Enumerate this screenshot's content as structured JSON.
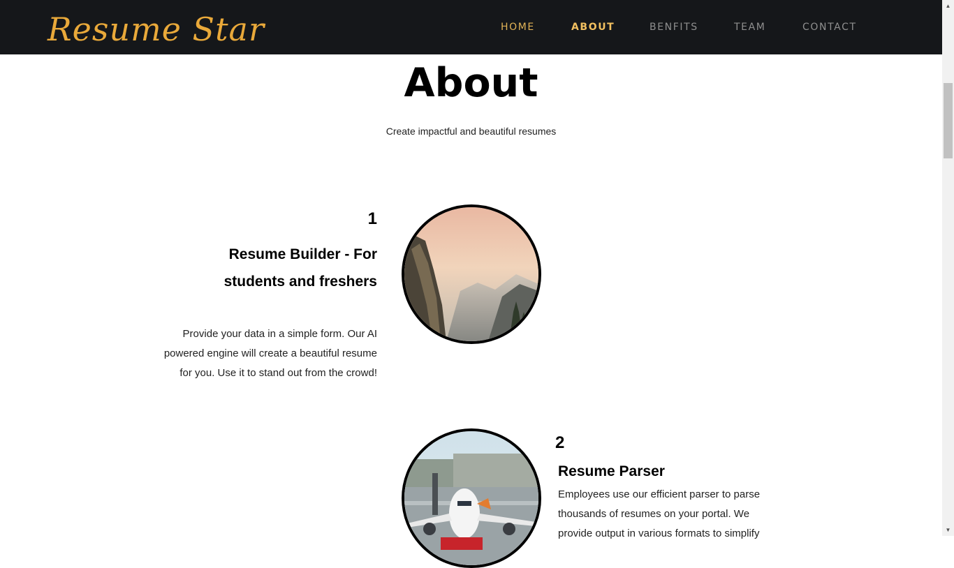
{
  "nav": {
    "brand": "Resume Star",
    "links": [
      "HOME",
      "ABOUT",
      "BENFITS",
      "TEAM",
      "CONTACT"
    ],
    "active": "ABOUT"
  },
  "about": {
    "title": "About",
    "subtitle": "Create impactful and beautiful resumes"
  },
  "items": [
    {
      "number": "1",
      "heading": "Resume Builder - For students and freshers",
      "description": "Provide your data in a simple form. Our AI powered engine will create a beautiful resume for you. Use it to stand out from the crowd!",
      "image": "mountain-valley-photo"
    },
    {
      "number": "2",
      "heading": "Resume Parser",
      "description": "Employees use our efficient parser to parse thousands of resumes on your portal. We provide output in various formats to simplify",
      "image": "airplane-photo"
    }
  ],
  "colors": {
    "navbar": "#15171a",
    "brand": "#e9a93a",
    "nav_active": "#f2c060"
  }
}
